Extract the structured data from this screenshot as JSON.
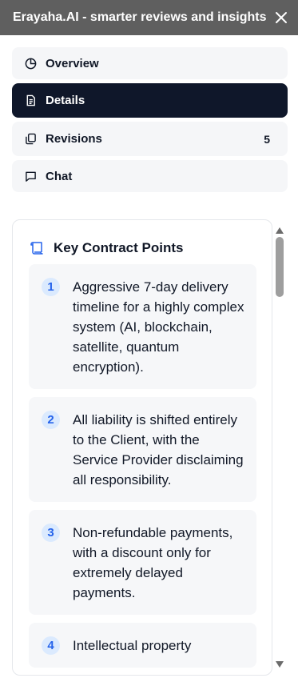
{
  "window": {
    "title": "Erayaha.AI - smarter reviews and insights",
    "close_icon": "close-icon"
  },
  "nav": {
    "items": [
      {
        "label": "Overview",
        "icon": "pie-chart-icon"
      },
      {
        "label": "Details",
        "icon": "document-icon"
      },
      {
        "label": "Revisions",
        "icon": "copy-icon",
        "count": "5"
      },
      {
        "label": "Chat",
        "icon": "chat-bubble-icon"
      }
    ],
    "active": "Details"
  },
  "panel": {
    "title": "Key Contract Points",
    "icon": "scroll-icon",
    "points": [
      {
        "number": "1",
        "text": "Aggressive 7-day delivery timeline for a highly complex system (AI, blockchain, satellite, quantum encryption)."
      },
      {
        "number": "2",
        "text": "All liability is shifted entirely to the Client, with the Service Provider disclaiming all responsibility."
      },
      {
        "number": "3",
        "text": "Non-refundable payments, with a discount only for extremely delayed payments."
      },
      {
        "number": "4",
        "text": "Intellectual property"
      }
    ]
  },
  "colors": {
    "titlebar": "#5f5f5f",
    "active_nav": "#0f172a",
    "badge_bg": "#dbeafe",
    "badge_text": "#2563eb",
    "accent_icon": "#2563eb"
  }
}
